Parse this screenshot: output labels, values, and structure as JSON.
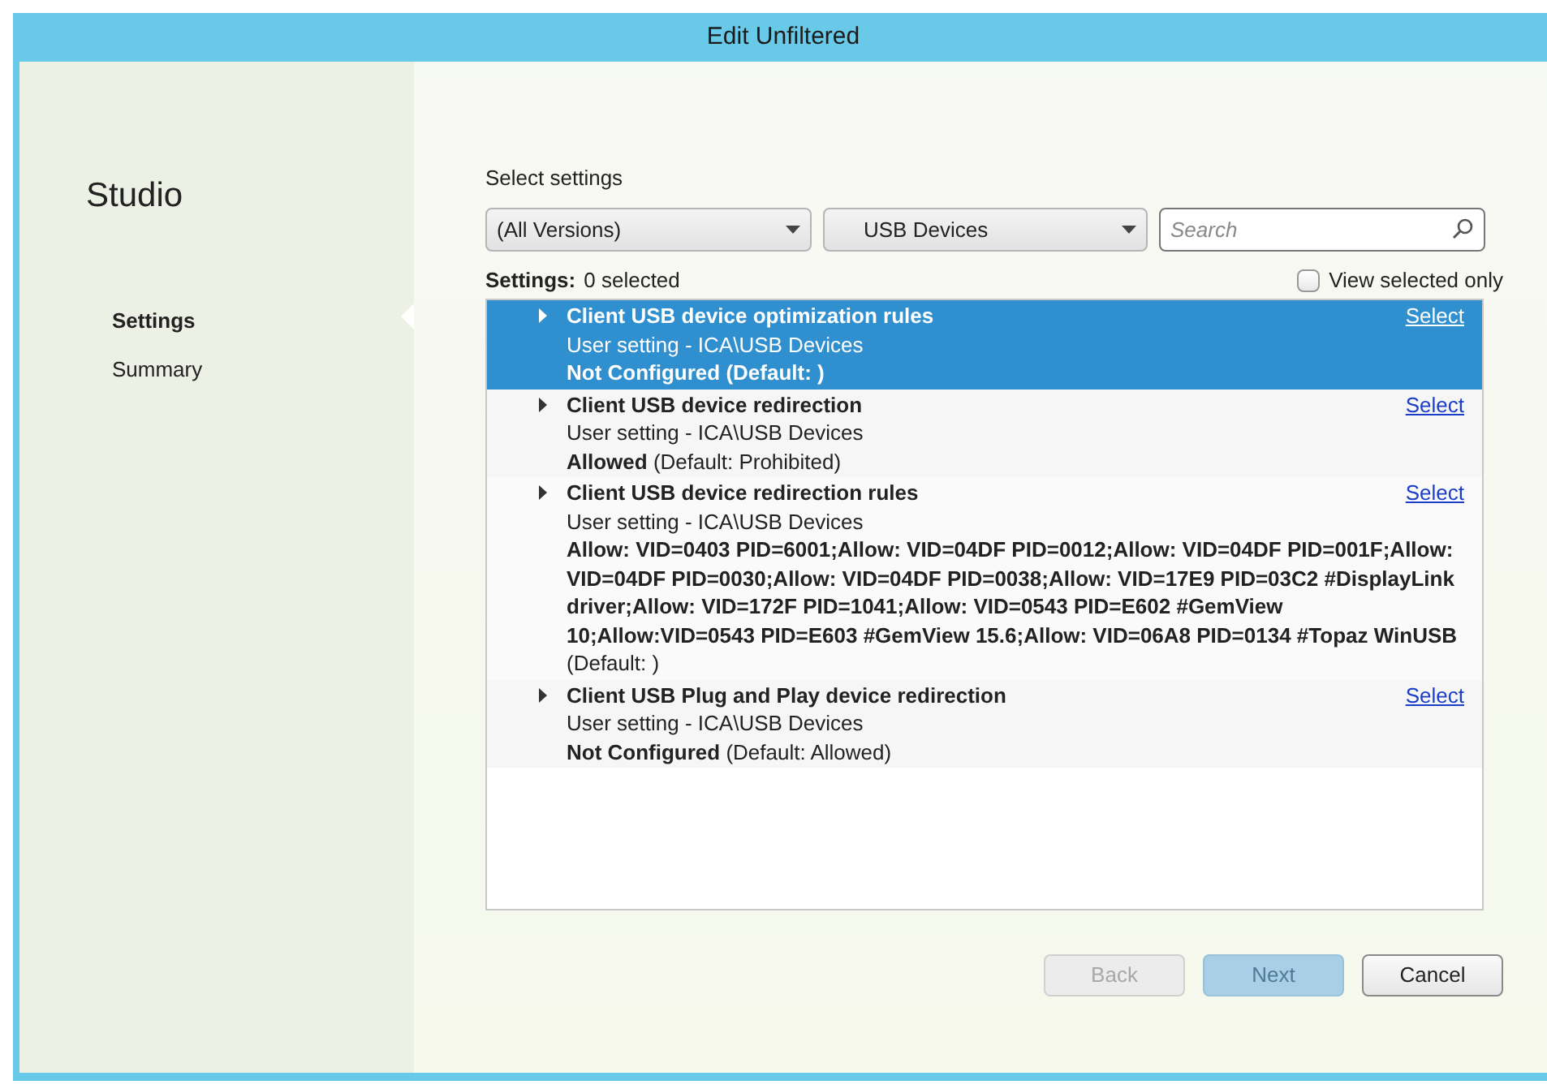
{
  "window": {
    "title": "Edit Unfiltered"
  },
  "sidebar": {
    "title": "Studio",
    "items": [
      {
        "label": "Settings",
        "selected": true
      },
      {
        "label": "Summary",
        "selected": false
      }
    ]
  },
  "heading": "Select settings",
  "filters": {
    "version": "(All Versions)",
    "category": "USB Devices",
    "search": {
      "placeholder": "Search"
    }
  },
  "settings_count": {
    "label": "Settings:",
    "value": "0 selected"
  },
  "view_selected_only": {
    "label": "View selected only",
    "checked": false
  },
  "settings": [
    {
      "name": "Client USB device optimization rules",
      "path": "User setting - ICA\\USB Devices",
      "value": "**Not Configured** **(Default: )**",
      "link": "Select",
      "selected": true
    },
    {
      "name": "Client USB device redirection",
      "path": "User setting - ICA\\USB Devices",
      "value": "**Allowed** (Default: Prohibited)",
      "link": "Select",
      "selected": false
    },
    {
      "name": "Client USB device redirection rules",
      "path": "User setting - ICA\\USB Devices",
      "value": "**Allow: VID=0403 PID=6001;Allow: VID=04DF PID=0012;Allow: VID=04DF PID=001F;Allow: VID=04DF PID=0030;Allow: VID=04DF PID=0038;Allow: VID=17E9 PID=03C2 #DisplayLink driver;Allow: VID=172F PID=1041;Allow: VID=0543 PID=E602 #GemView 10;Allow:VID=0543 PID=E603 #GemView 15.6;Allow: VID=06A8 PID=0134 #Topaz WinUSB** (Default: )",
      "link": "Select",
      "selected": false
    },
    {
      "name": "Client USB Plug and Play device redirection",
      "path": "User setting - ICA\\USB Devices",
      "value": "**Not Configured** (Default: Allowed)",
      "link": "Select",
      "selected": false
    }
  ],
  "buttons": [
    {
      "label": "Back",
      "kind": "plain",
      "disabled": true
    },
    {
      "label": "Next",
      "kind": "primary",
      "disabled": true
    },
    {
      "label": "Cancel",
      "kind": "plain",
      "disabled": false
    }
  ]
}
